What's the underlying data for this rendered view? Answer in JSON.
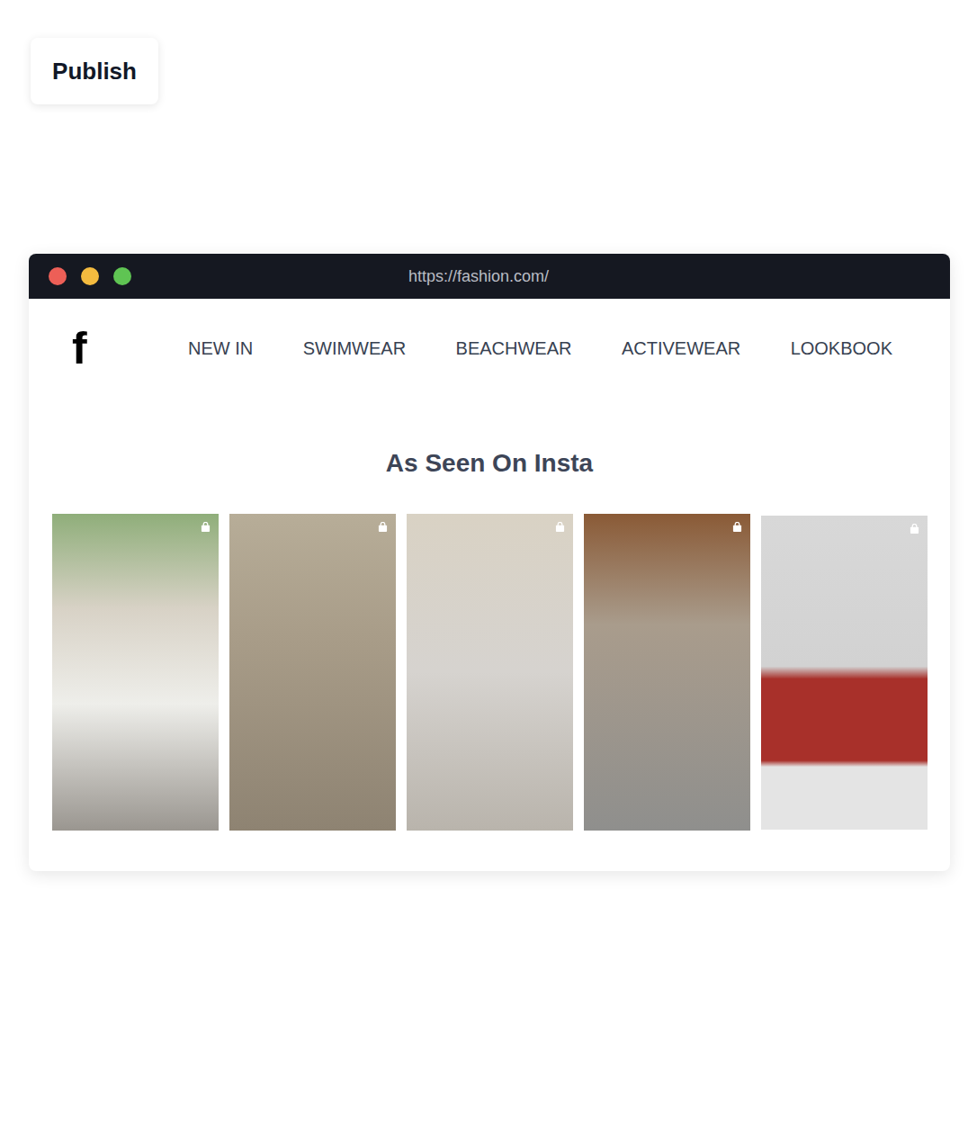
{
  "publish_button": {
    "label": "Publish"
  },
  "browser": {
    "url": "https://fashion.com/"
  },
  "site": {
    "logo": "f",
    "nav": [
      {
        "label": "NEW IN"
      },
      {
        "label": "SWIMWEAR"
      },
      {
        "label": "BEACHWEAR"
      },
      {
        "label": "ACTIVEWEAR"
      },
      {
        "label": "LOOKBOOK"
      }
    ],
    "section_title": "As Seen On Insta",
    "posts": [
      {
        "shoppable": true
      },
      {
        "shoppable": true
      },
      {
        "shoppable": true
      },
      {
        "shoppable": true
      },
      {
        "shoppable": true
      }
    ]
  }
}
